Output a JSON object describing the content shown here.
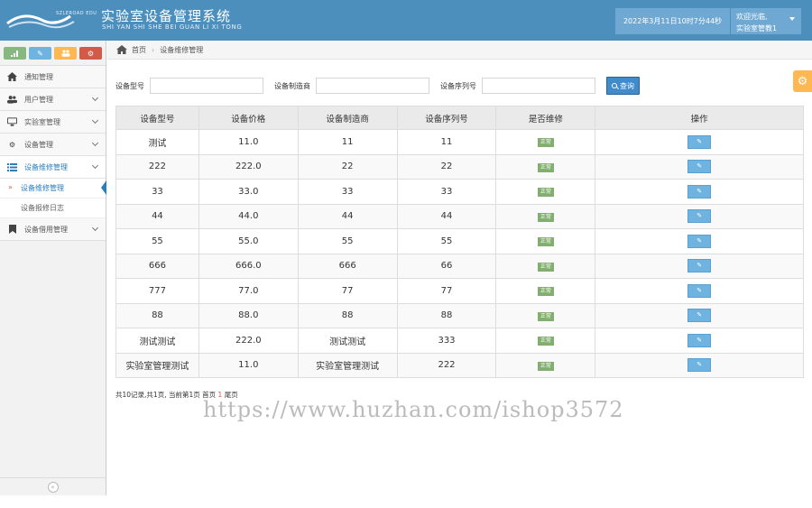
{
  "header": {
    "logo_text": "SZLEROAD EDU",
    "title": "实验室设备管理系统",
    "subtitle": "SHI YAN SHI SHE BEI GUAN LI XI TONG",
    "datetime": "2022年3月11日10时7分44秒",
    "welcome": "欢迎光临,",
    "username": "实验室管教1",
    "colors": {
      "header_bg": "#4c8fbd",
      "info_box": "#6fa9d3"
    }
  },
  "sidebar": {
    "shortcuts": [
      {
        "icon": "signal-icon"
      },
      {
        "icon": "pencil-icon"
      },
      {
        "icon": "group-icon"
      },
      {
        "icon": "cogs-icon"
      }
    ],
    "items": [
      {
        "label": "通知管理",
        "icon": "home-icon"
      },
      {
        "label": "用户管理",
        "icon": "users-icon"
      },
      {
        "label": "实验室管理",
        "icon": "desktop-icon"
      },
      {
        "label": "设备管理",
        "icon": "cogs-icon"
      },
      {
        "label": "设备维修管理",
        "icon": "list-icon",
        "expanded": true,
        "children": [
          {
            "label": "设备维修管理",
            "active": true
          },
          {
            "label": "设备报修日志"
          }
        ]
      },
      {
        "label": "设备借用管理",
        "icon": "bookmark-icon"
      }
    ],
    "collapse_glyph": "«"
  },
  "breadcrumb": {
    "home": "首页",
    "current": "设备维修管理"
  },
  "search": {
    "model_label": "设备型号",
    "model_value": "",
    "maker_label": "设备制造商",
    "maker_value": "",
    "serial_label": "设备序列号",
    "serial_value": "",
    "query_label": "查询"
  },
  "table": {
    "headers": [
      "设备型号",
      "设备价格",
      "设备制造商",
      "设备序列号",
      "是否维修",
      "操作"
    ],
    "rows": [
      [
        "测试",
        "11.0",
        "11",
        "11",
        "正常"
      ],
      [
        "222",
        "222.0",
        "22",
        "22",
        "正常"
      ],
      [
        "33",
        "33.0",
        "33",
        "33",
        "正常"
      ],
      [
        "44",
        "44.0",
        "44",
        "44",
        "正常"
      ],
      [
        "55",
        "55.0",
        "55",
        "55",
        "正常"
      ],
      [
        "666",
        "666.0",
        "666",
        "66",
        "正常"
      ],
      [
        "777",
        "77.0",
        "77",
        "77",
        "正常"
      ],
      [
        "88",
        "88.0",
        "88",
        "88",
        "正常"
      ],
      [
        "测试测试",
        "222.0",
        "测试测试",
        "333",
        "正常"
      ],
      [
        "实验室管理测试",
        "11.0",
        "实验室管理测试",
        "222",
        "正常"
      ]
    ],
    "status_color": "#82af6f",
    "edit_color": "#6fb3e0"
  },
  "pager": {
    "summary": "共10记录,共1页, 当前第1页",
    "first": "首页",
    "current": "1",
    "last": "尾页"
  },
  "watermark": "https://www.huzhan.com/ishop3572"
}
